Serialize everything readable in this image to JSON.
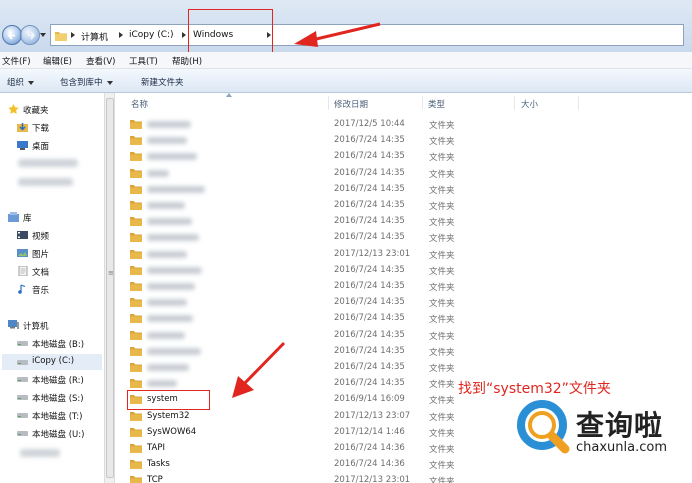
{
  "address": {
    "crumbs": [
      "计算机",
      "iCopy (C:)",
      "Windows"
    ]
  },
  "menubar": [
    "文件(F)",
    "编辑(E)",
    "查看(V)",
    "工具(T)",
    "帮助(H)"
  ],
  "toolbar": {
    "organize": "组织",
    "include_in_library": "包含到库中",
    "new_folder": "新建文件夹"
  },
  "nav": {
    "favorites": "收藏夹",
    "downloads": "下载",
    "desktop": "桌面",
    "libraries": "库",
    "videos": "视频",
    "pictures": "图片",
    "documents": "文档",
    "music": "音乐",
    "computer": "计算机",
    "drives": [
      "本地磁盘 (B:)",
      "iCopy (C:)",
      "本地磁盘 (R:)",
      "本地磁盘 (S:)",
      "本地磁盘 (T:)",
      "本地磁盘 (U:)"
    ]
  },
  "columns": {
    "name": "名称",
    "modified": "修改日期",
    "type": "类型",
    "size": "大小"
  },
  "files": [
    {
      "name": "",
      "date": "2017/12/5 10:44",
      "type": "文件夹"
    },
    {
      "name": "",
      "date": "2016/7/24 14:35",
      "type": "文件夹"
    },
    {
      "name": "",
      "date": "2016/7/24 14:35",
      "type": "文件夹"
    },
    {
      "name": "",
      "date": "2016/7/24 14:35",
      "type": "文件夹"
    },
    {
      "name": "",
      "date": "2016/7/24 14:35",
      "type": "文件夹"
    },
    {
      "name": "",
      "date": "2016/7/24 14:35",
      "type": "文件夹"
    },
    {
      "name": "",
      "date": "2016/7/24 14:35",
      "type": "文件夹"
    },
    {
      "name": "",
      "date": "2016/7/24 14:35",
      "type": "文件夹"
    },
    {
      "name": "",
      "date": "2017/12/13 23:01",
      "type": "文件夹"
    },
    {
      "name": "",
      "date": "2016/7/24 14:35",
      "type": "文件夹"
    },
    {
      "name": "",
      "date": "2016/7/24 14:35",
      "type": "文件夹"
    },
    {
      "name": "",
      "date": "2016/7/24 14:35",
      "type": "文件夹"
    },
    {
      "name": "",
      "date": "2016/7/24 14:35",
      "type": "文件夹"
    },
    {
      "name": "",
      "date": "2016/7/24 14:35",
      "type": "文件夹"
    },
    {
      "name": "",
      "date": "2016/7/24 14:35",
      "type": "文件夹"
    },
    {
      "name": "",
      "date": "2016/7/24 14:35",
      "type": "文件夹"
    },
    {
      "name": "",
      "date": "2016/7/24 14:35",
      "type": "文件夹"
    },
    {
      "name": "system",
      "date": "2016/9/14 16:09",
      "type": "文件夹"
    },
    {
      "name": "System32",
      "date": "2017/12/13 23:07",
      "type": "文件夹"
    },
    {
      "name": "SysWOW64",
      "date": "2017/12/14 1:46",
      "type": "文件夹"
    },
    {
      "name": "TAPI",
      "date": "2016/7/24 14:36",
      "type": "文件夹"
    },
    {
      "name": "Tasks",
      "date": "2016/7/24 14:36",
      "type": "文件夹"
    },
    {
      "name": "TCP",
      "date": "2017/12/13 23:01",
      "type": "文件夹"
    }
  ],
  "annotation": "找到“system32”文件夹",
  "watermark": {
    "brand": "查询啦",
    "url": "chaxunla.com"
  },
  "colors": {
    "highlight": "#e0261e",
    "folder": "#e8b84a"
  }
}
